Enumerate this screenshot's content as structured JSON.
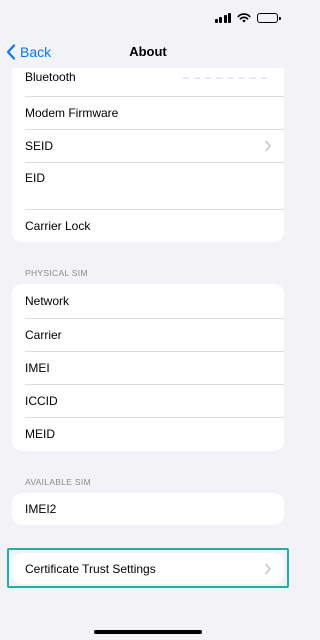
{
  "nav": {
    "back_label": "Back",
    "title": "About"
  },
  "battery_level": 0.85,
  "group1": {
    "rows": [
      {
        "label": "Bluetooth",
        "value": "– – – – – – – –"
      },
      {
        "label": "Modem Firmware"
      },
      {
        "label": "SEID",
        "has_chevron": true
      },
      {
        "label": "EID"
      },
      {
        "label": "Carrier Lock"
      }
    ]
  },
  "physical_sim": {
    "header": "PHYSICAL SIM",
    "rows": [
      {
        "label": "Network"
      },
      {
        "label": "Carrier"
      },
      {
        "label": "IMEI"
      },
      {
        "label": "ICCID"
      },
      {
        "label": "MEID"
      }
    ]
  },
  "available_sim": {
    "header": "AVAILABLE SIM",
    "rows": [
      {
        "label": "IMEI2"
      }
    ]
  },
  "certificate": {
    "label": "Certificate Trust Settings",
    "highlight_color": "#16b3a8"
  },
  "colors": {
    "accent": "#007aff",
    "background": "#f2f2f7"
  }
}
